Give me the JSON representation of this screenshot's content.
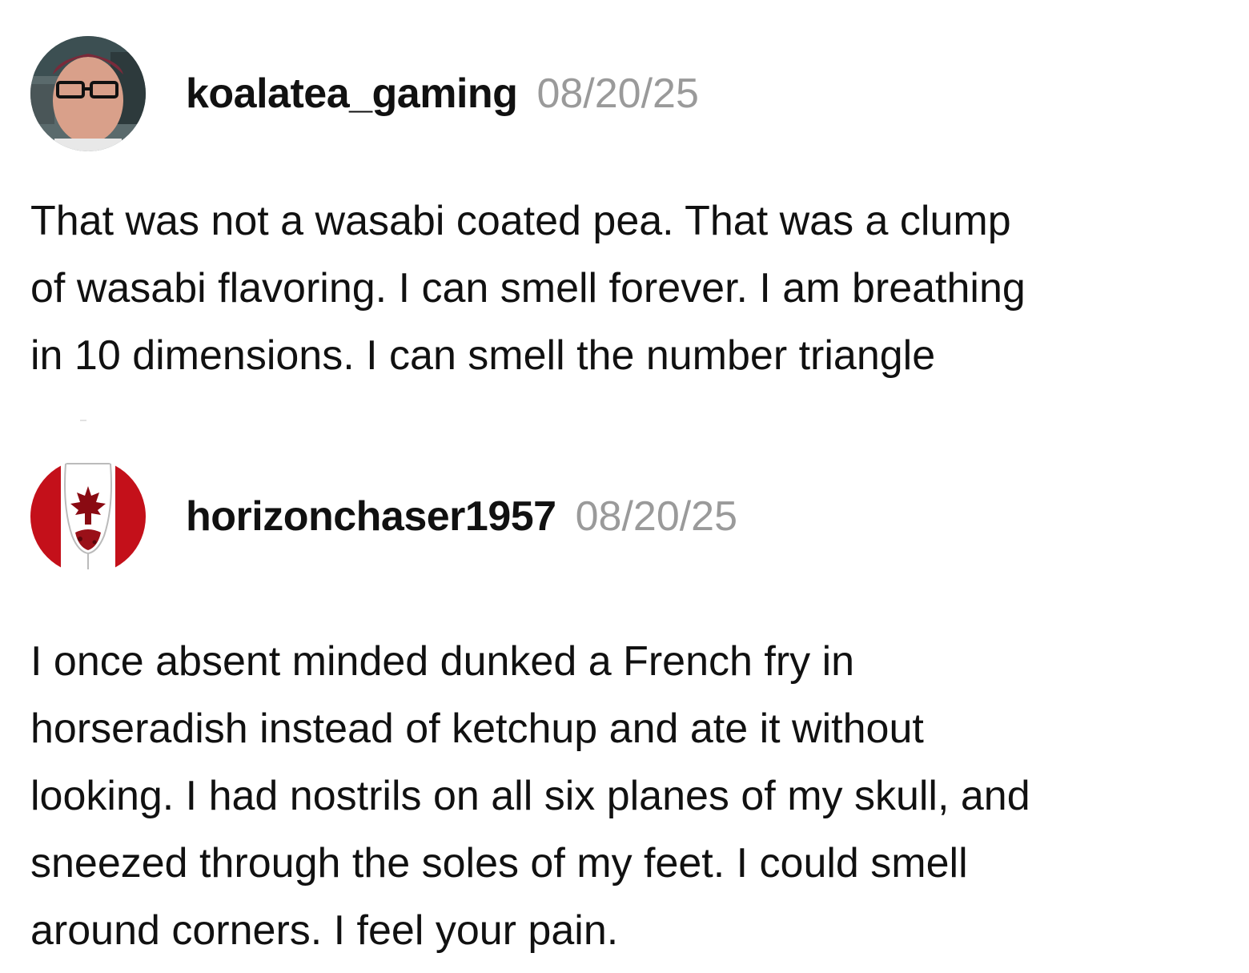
{
  "comments": [
    {
      "username": "koalatea_gaming",
      "date": "08/20/25",
      "lines": [
        "That was not a wasabi coated pea. That was a clump",
        "of wasabi flavoring. I can smell forever. I am breathing",
        "in 10 dimensions. I can smell the number triangle"
      ]
    },
    {
      "username": "horizonchaser1957",
      "date": "08/20/25",
      "lines": [
        "I once absent minded dunked a French fry in",
        "horseradish instead of ketchup and ate it without",
        "looking. I had nostrils on all six planes of my skull, and",
        "sneezed through the soles of my feet. I could smell",
        "around corners. I feel your pain."
      ]
    }
  ]
}
